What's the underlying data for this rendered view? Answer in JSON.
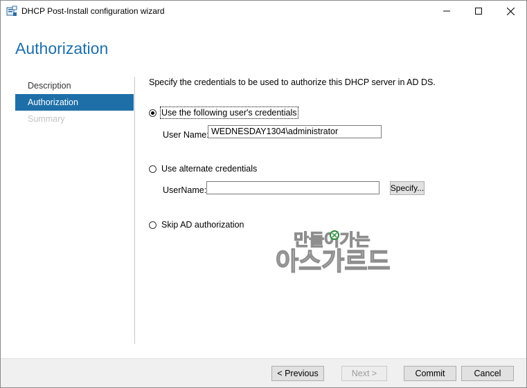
{
  "window": {
    "title": "DHCP Post-Install configuration wizard",
    "icons": {
      "app": "server-icon",
      "minimize": "minimize-icon",
      "maximize": "maximize-icon",
      "close": "close-icon"
    }
  },
  "page": {
    "heading": "Authorization"
  },
  "nav": {
    "items": [
      {
        "label": "Description",
        "state": "normal"
      },
      {
        "label": "Authorization",
        "state": "selected"
      },
      {
        "label": "Summary",
        "state": "disabled"
      }
    ]
  },
  "content": {
    "intro": "Specify the credentials to be used to authorize this DHCP server in AD DS.",
    "option_current": {
      "label": "Use the following user's credentials",
      "checked": true
    },
    "current_user_label": "User Name:",
    "current_user_value": "WEDNESDAY1304\\administrator",
    "option_alternate": {
      "label": "Use alternate credentials",
      "checked": false
    },
    "alternate_user_label": "UserName:",
    "alternate_user_value": "",
    "specify_button": "Specify...",
    "option_skip": {
      "label": "Skip AD authorization",
      "checked": false
    }
  },
  "watermark": {
    "line1": "만들어가는",
    "line2": "아스가르드"
  },
  "footer": {
    "previous": "< Previous",
    "next": "Next >",
    "commit": "Commit",
    "cancel": "Cancel"
  },
  "colors": {
    "accent": "#1e6fa8",
    "footer_bg": "#f0f0f0"
  }
}
